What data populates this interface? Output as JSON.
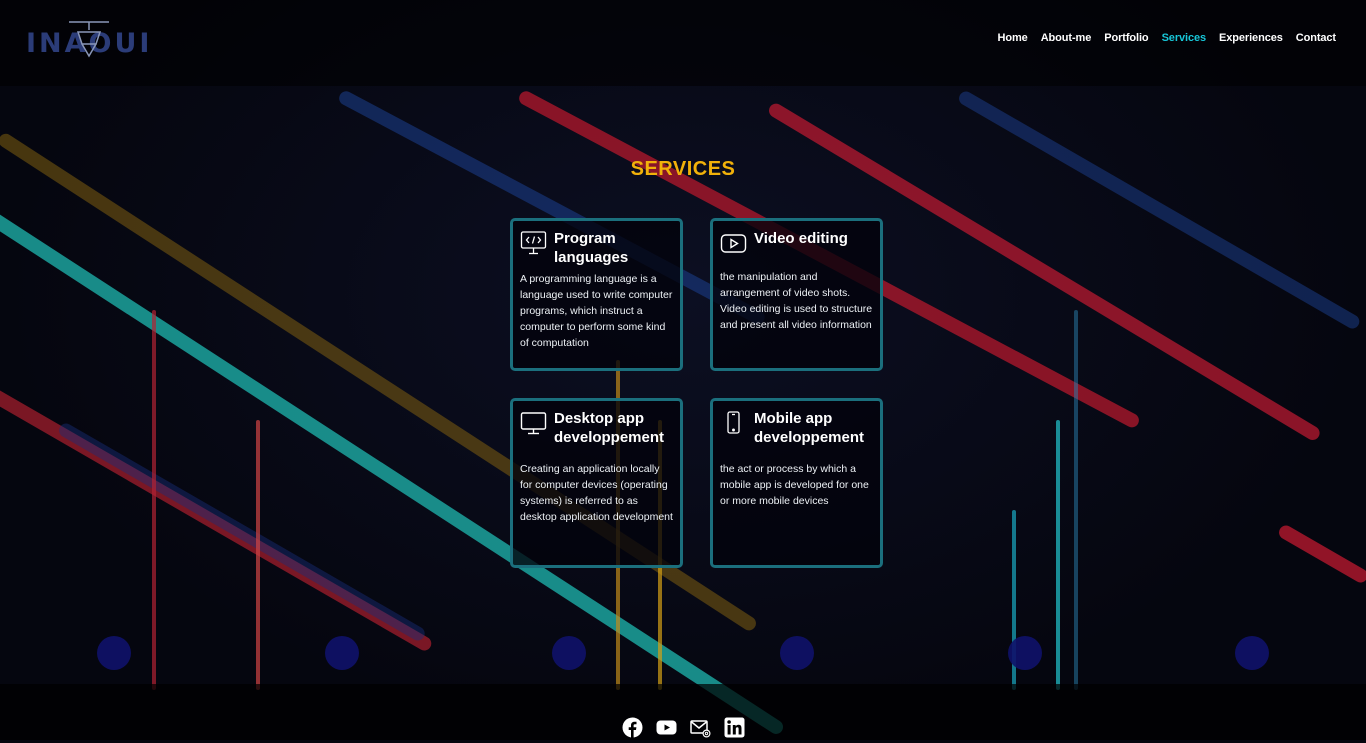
{
  "brand": {
    "logo_text": "INAOUI"
  },
  "nav": {
    "items": [
      {
        "label": "Home"
      },
      {
        "label": "About-me"
      },
      {
        "label": "Portfolio"
      },
      {
        "label": "Services",
        "active": true
      },
      {
        "label": "Experiences"
      },
      {
        "label": "Contact"
      }
    ]
  },
  "main": {
    "title": "SERVICES",
    "cards": [
      {
        "icon": "code-monitor-icon",
        "title": "Program languages",
        "text": "A programming language is a language used to write computer programs, which instruct a computer to perform some kind of computation"
      },
      {
        "icon": "video-play-icon",
        "title": "Video editing",
        "text": "the manipulation and arrangement of video shots. Video editing is used to structure and present all video information"
      },
      {
        "icon": "desktop-icon",
        "title": "Desktop app developpement",
        "text": "Creating an application locally for computer devices (operating systems) is referred to as desktop application development"
      },
      {
        "icon": "mobile-phone-icon",
        "title": "Mobile app developpement",
        "text": "the act or process by which a mobile app is developed for one or more mobile devices"
      }
    ]
  },
  "footer": {
    "social": [
      "facebook-icon",
      "youtube-icon",
      "email-icon",
      "linkedin-icon"
    ]
  },
  "colors": {
    "accent": "#17c6d8",
    "title": "#f1b10a",
    "card_border": "#1b6f7d",
    "background": "#05060f"
  }
}
